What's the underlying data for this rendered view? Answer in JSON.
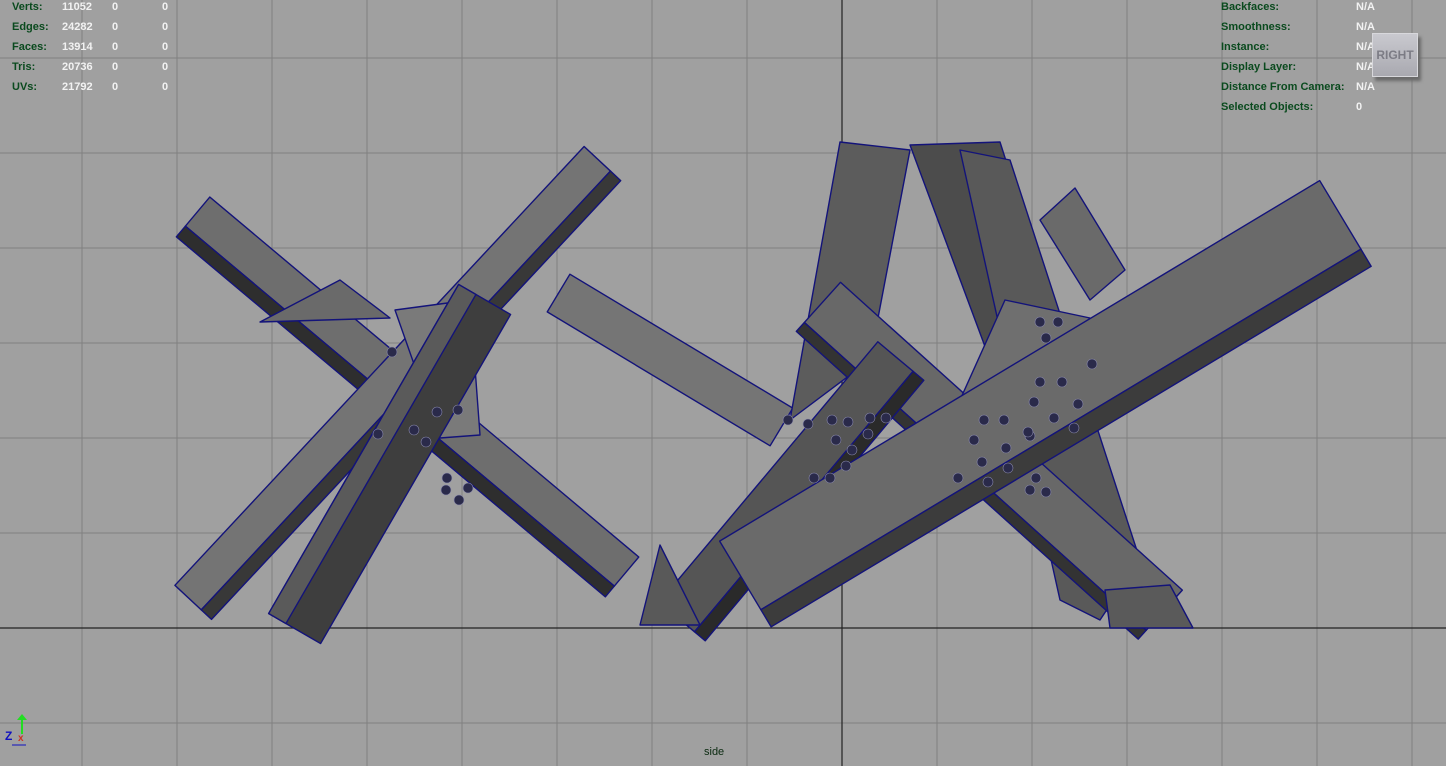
{
  "stats": [
    {
      "label": "Verts:",
      "values": [
        "11052",
        "0",
        "0"
      ]
    },
    {
      "label": "Edges:",
      "values": [
        "24282",
        "0",
        "0"
      ]
    },
    {
      "label": "Faces:",
      "values": [
        "13914",
        "0",
        "0"
      ]
    },
    {
      "label": "Tris:",
      "values": [
        "20736",
        "0",
        "0"
      ]
    },
    {
      "label": "UVs:",
      "values": [
        "21792",
        "0",
        "0"
      ]
    }
  ],
  "object_info": [
    {
      "label": "Backfaces:",
      "value": "N/A"
    },
    {
      "label": "Smoothness:",
      "value": "N/A"
    },
    {
      "label": "Instance:",
      "value": "N/A"
    },
    {
      "label": "Display Layer:",
      "value": "N/A"
    },
    {
      "label": "Distance From Camera:",
      "value": "N/A"
    },
    {
      "label": "Selected Objects:",
      "value": "0"
    }
  ],
  "viewcube_label": "RIGHT",
  "camera_name": "side",
  "axis": {
    "z_label": "Z"
  },
  "colors": {
    "background": "#a0a0a0",
    "grid": "#7e7e7e",
    "wire": "#10107a",
    "hud_label": "#0a4a1e"
  }
}
